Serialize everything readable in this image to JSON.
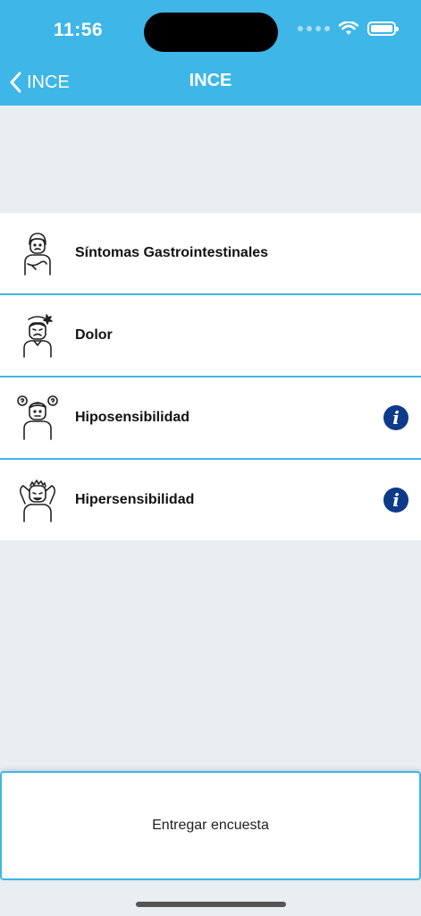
{
  "status_bar": {
    "time": "11:56"
  },
  "nav": {
    "back_label": "INCE",
    "title": "INCE"
  },
  "items": [
    {
      "label": "Síntomas Gastrointestinales",
      "icon": "stomach-ache-person-icon",
      "info": false
    },
    {
      "label": "Dolor",
      "icon": "headache-person-icon",
      "info": false
    },
    {
      "label": "Hiposensibilidad",
      "icon": "confused-person-icon",
      "info": true
    },
    {
      "label": "Hipersensibilidad",
      "icon": "overwhelmed-person-icon",
      "info": true
    }
  ],
  "info_icon_label": "i",
  "submit": {
    "label": "Entregar encuesta"
  },
  "colors": {
    "accent": "#3fb6e8",
    "background": "#e8eef2",
    "info": "#0d3a8a"
  }
}
